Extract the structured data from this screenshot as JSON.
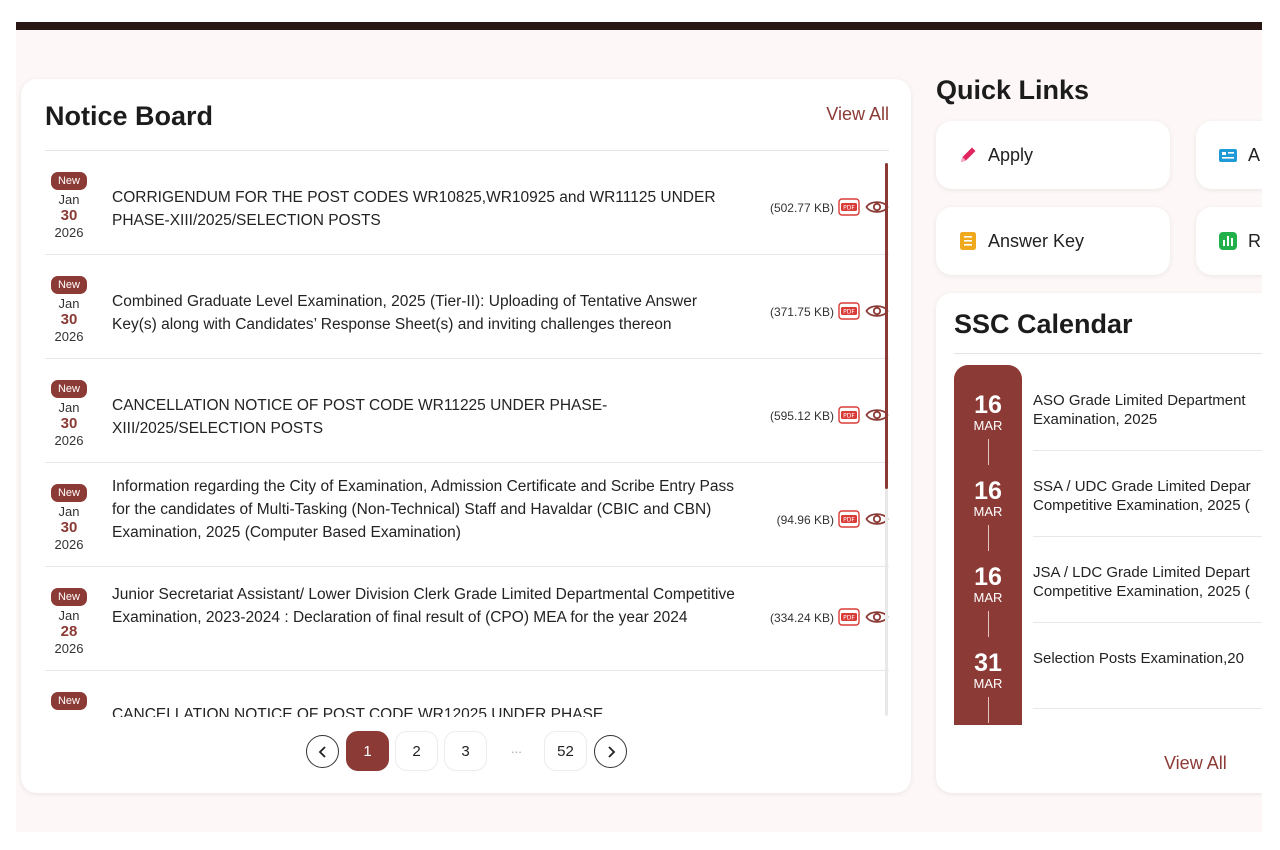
{
  "notice_board": {
    "title": "Notice Board",
    "view_all": "View All",
    "items": [
      {
        "badge": "New",
        "month": "Jan",
        "day": "30",
        "year": "2026",
        "text": "CORRIGENDUM FOR THE POST CODES WR10825,WR10925 and WR11125 UNDER PHASE-XIII/2025/SELECTION POSTS",
        "size": "(502.77 KB)"
      },
      {
        "badge": "New",
        "month": "Jan",
        "day": "30",
        "year": "2026",
        "text": "Combined Graduate Level Examination, 2025 (Tier-II): Uploading of Tentative Answer Key(s) along with Candidates’ Response Sheet(s) and inviting challenges thereon",
        "size": "(371.75 KB)"
      },
      {
        "badge": "New",
        "month": "Jan",
        "day": "30",
        "year": "2026",
        "text": "CANCELLATION NOTICE OF POST CODE WR11225 UNDER PHASE-XIII/2025/SELECTION POSTS",
        "size": "(595.12 KB)"
      },
      {
        "badge": "New",
        "month": "Jan",
        "day": "30",
        "year": "2026",
        "text": "Information regarding the City of Examination, Admission Certificate and Scribe Entry Pass for the candidates of Multi-Tasking (Non-Technical) Staff and Havaldar (CBIC and CBN) Examination, 2025 (Computer Based Examination)",
        "size": "(94.96 KB)"
      },
      {
        "badge": "New",
        "month": "Jan",
        "day": "28",
        "year": "2026",
        "text": "Junior Secretariat Assistant/ Lower Division Clerk Grade Limited Departmental Competitive Examination, 2023-2024 : Declaration of final result of (CPO) MEA for the year 2024",
        "size": "(334.24 KB)"
      },
      {
        "badge": "New",
        "month": "",
        "day": "",
        "year": "",
        "text": "CANCELLATION NOTICE OF POST CODE WR12025 UNDER PHASE",
        "size": ""
      }
    ],
    "pdf_label": "PDF",
    "pagination": {
      "pages": [
        "1",
        "2",
        "3"
      ],
      "ellipsis": "...",
      "last": "52",
      "current": "1"
    }
  },
  "quick_links": {
    "title": "Quick Links",
    "items": [
      {
        "label": "Apply",
        "icon": "pencil-icon",
        "color": "#e0245e"
      },
      {
        "label": "A",
        "icon": "admit-card-icon",
        "color": "#1e9bd7"
      },
      {
        "label": "Answer Key",
        "icon": "answer-key-icon",
        "color": "#f0a81c"
      },
      {
        "label": "R",
        "icon": "result-chart-icon",
        "color": "#22b04b"
      }
    ]
  },
  "calendar": {
    "title": "SSC Calendar",
    "view_all": "View All",
    "items": [
      {
        "day": "16",
        "month": "MAR",
        "line1": "ASO Grade Limited Department",
        "line2": "Examination, 2025"
      },
      {
        "day": "16",
        "month": "MAR",
        "line1": "SSA / UDC Grade Limited Depar",
        "line2": "Competitive Examination, 2025 ("
      },
      {
        "day": "16",
        "month": "MAR",
        "line1": "JSA / LDC Grade Limited Depart",
        "line2": "Competitive Examination, 2025 ("
      },
      {
        "day": "31",
        "month": "MAR",
        "line1": "Selection Posts Examination,20",
        "line2": ""
      }
    ]
  },
  "colors": {
    "brand": "#8b3a35",
    "topbar": "#2a1515"
  }
}
